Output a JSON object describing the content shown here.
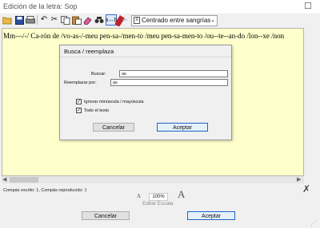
{
  "window": {
    "title": "Edición de la letra: Sop",
    "close_label": "☐"
  },
  "toolbar": {
    "icons": [
      "open-folder-icon",
      "save-icon",
      "print-icon",
      "undo-icon",
      "cut-icon",
      "copy-icon",
      "paste-icon",
      "eraser-icon",
      "find-icon",
      "find-replace-icon",
      "syllable-hyphen-icon"
    ],
    "find_replace_glyph": "a↔b",
    "alignment": {
      "value": "Centrado entre sangrías",
      "icon": "align-center-icon"
    }
  },
  "editor": {
    "text": "Mm---/-/ Ca-rón de /vo-as-/-meu pen-sa-/men-to /meu pen-sa-men-to /ou--te--an-do /lon--xe /non",
    "background": "#ffffcc"
  },
  "dialog": {
    "title": "Busca / reemplaza",
    "find_label": "Buscar:",
    "find_value": "as",
    "replace_label": "Reemplazar por:",
    "replace_value": "as",
    "options": [
      {
        "label": "Ignorar minúscula / mayúscula",
        "checked": true
      },
      {
        "label": "Todo el texto",
        "checked": true
      }
    ],
    "cancel_label": "Cancelar",
    "accept_label": "Aceptar"
  },
  "status": {
    "text": "Compás escrito: 1, Compás reproducido: 1"
  },
  "scale": {
    "small_a": "A",
    "large_a": "A",
    "value": "100%",
    "label": "Editar Escala"
  },
  "buttons": {
    "cancel_label": "Cancelar",
    "accept_label": "Aceptar"
  },
  "colors": {
    "accent": "#1e63c7",
    "editor_bg": "#ffffcc"
  }
}
